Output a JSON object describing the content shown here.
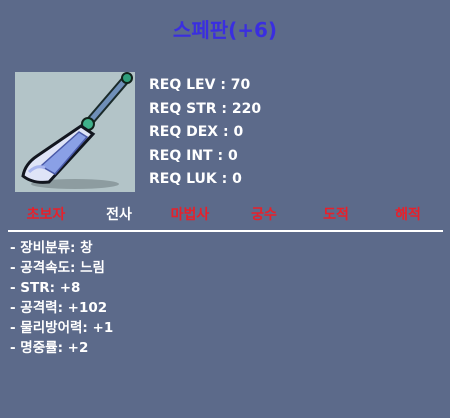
{
  "item": {
    "title": "스페판(+6)",
    "icon": "spear-icon"
  },
  "requirements": [
    {
      "label": "REQ LEV : 70"
    },
    {
      "label": "REQ STR : 220"
    },
    {
      "label": "REQ DEX : 0"
    },
    {
      "label": "REQ INT : 0"
    },
    {
      "label": "REQ LUK : 0"
    }
  ],
  "jobs": [
    {
      "name": "초보자",
      "allowed": false
    },
    {
      "name": "전사",
      "allowed": true
    },
    {
      "name": "마법사",
      "allowed": false
    },
    {
      "name": "궁수",
      "allowed": false
    },
    {
      "name": "도적",
      "allowed": false
    },
    {
      "name": "해적",
      "allowed": false
    }
  ],
  "stats": [
    "- 장비분류: 창",
    "- 공격속도: 느림",
    "- STR: +8",
    "- 공격력: +102",
    "- 물리방어력: +1",
    "- 명중률: +2"
  ],
  "colors": {
    "background": "#5c6a8a",
    "title": "#3a2ee0",
    "job_denied": "#e8202a",
    "job_allowed": "#ffffff",
    "icon_bg": "#b3c4c8"
  }
}
